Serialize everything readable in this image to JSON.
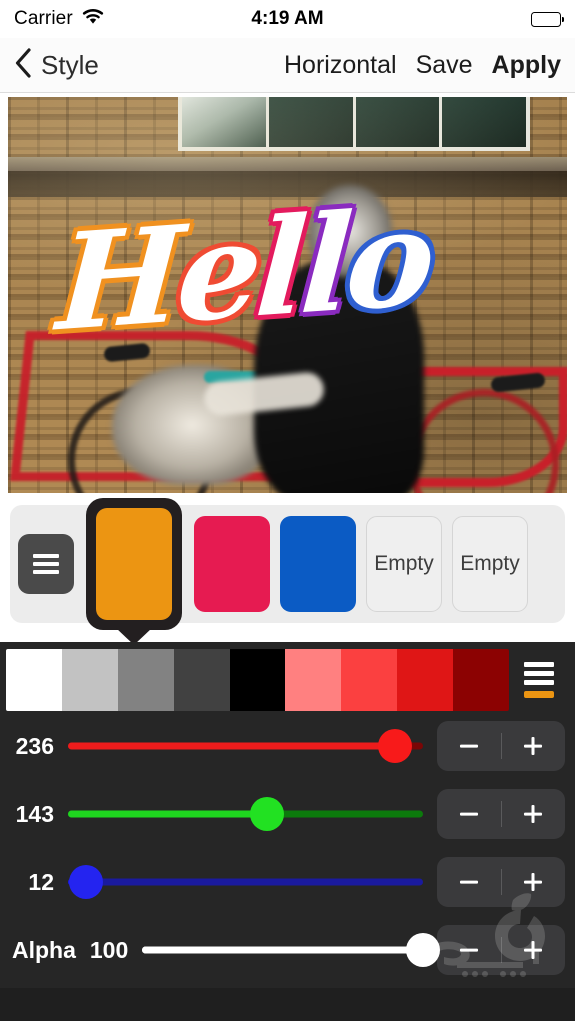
{
  "status_bar": {
    "carrier": "Carrier",
    "wifi_icon": "wifi-icon",
    "time": "4:19 AM",
    "battery_icon": "battery-full-icon"
  },
  "nav_bar": {
    "back_icon": "chevron-left-icon",
    "back_label": "Style",
    "actions": [
      {
        "label": "Horizontal",
        "bold": false
      },
      {
        "label": "Save",
        "bold": false
      },
      {
        "label": "Apply",
        "bold": true
      }
    ]
  },
  "canvas": {
    "artwork_text": "Hello",
    "letters": [
      "H",
      "e",
      "l",
      "l",
      "o"
    ]
  },
  "swatch_bar": {
    "menu_icon": "hamburger-menu-icon",
    "selected_index": 0,
    "swatches": [
      {
        "type": "color",
        "color": "#EC9512",
        "label": ""
      },
      {
        "type": "color",
        "color": "#E61B51",
        "label": ""
      },
      {
        "type": "color",
        "color": "#0B5BC4",
        "label": ""
      },
      {
        "type": "empty",
        "color": "#EFEFEF",
        "label": "Empty"
      },
      {
        "type": "empty",
        "color": "#EFEFEF",
        "label": "Empty"
      }
    ]
  },
  "palette": {
    "cells": [
      "#FFFFFF",
      "#C2C2C2",
      "#828282",
      "#414141",
      "#000000",
      "#FF8080",
      "#FB4040",
      "#DF1616",
      "#8C0202"
    ],
    "menu_icon": "hamburger-menu-icon",
    "accent_color": "#EC9512"
  },
  "sliders": [
    {
      "name": "",
      "channel": "red",
      "value": "236",
      "percent": 92,
      "track_color": "#7A0606",
      "fill_color": "#EE1C1C",
      "thumb_color": "#F81A1A",
      "minus_label": "−",
      "plus_label": "+"
    },
    {
      "name": "",
      "channel": "green",
      "value": "143",
      "percent": 56,
      "track_color": "#0C7A0C",
      "fill_color": "#1FD51F",
      "thumb_color": "#22E122",
      "minus_label": "−",
      "plus_label": "+"
    },
    {
      "name": "",
      "channel": "blue",
      "value": "12",
      "percent": 5,
      "track_color": "#1A1A9E",
      "fill_color": "#1A1AE0",
      "thumb_color": "#2424F0",
      "minus_label": "−",
      "plus_label": "+"
    },
    {
      "name": "Alpha",
      "channel": "alpha",
      "value": "100",
      "percent": 100,
      "track_color": "#FFFFFF",
      "fill_color": "#FFFFFF",
      "thumb_color": "#FFFFFF",
      "minus_label": "−",
      "plus_label": "+"
    }
  ],
  "watermark": {
    "icon": "apple-logo-watermark"
  }
}
